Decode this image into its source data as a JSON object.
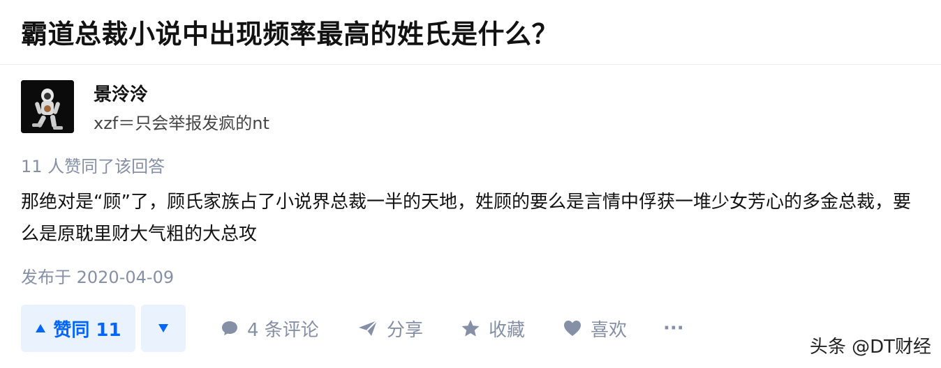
{
  "question": {
    "title": "霸道总裁小说中出现频率最高的姓氏是什么？"
  },
  "author": {
    "name": "景泠泠",
    "bio": "xzf＝只会举报发疯的nt"
  },
  "answer": {
    "vote_summary": "11 人赞同了该回答",
    "content": "那绝对是“顾”了，顾氏家族占了小说界总裁一半的天地，姓顾的要么是言情中俘获一堆少女芳心的多金总裁，要么是原耽里财大气粗的大总攻",
    "published": "发布于 2020-04-09"
  },
  "actions": {
    "upvote_label": "赞同 11",
    "comments_label": "4 条评论",
    "share_label": "分享",
    "collect_label": "收藏",
    "like_label": "喜欢",
    "more_label": "···"
  },
  "watermark": "头条 @DT财经",
  "colors": {
    "accent": "#0066ff",
    "accent_bg": "#eaf2fd",
    "muted": "#8590a6",
    "text": "#121212"
  }
}
